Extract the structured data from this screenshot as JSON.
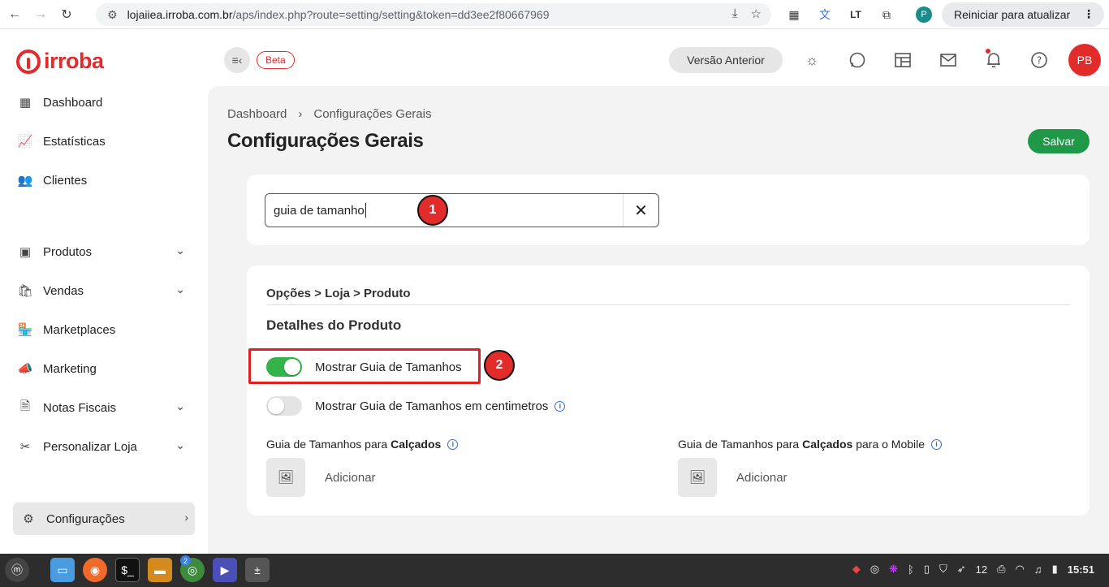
{
  "browser": {
    "url_host": "lojaiiea.irroba.com.br",
    "url_path": "/aps/index.php?route=setting/setting&token=dd3ee2f80667969",
    "profile_initial": "P",
    "restart_label": "Reiniciar para atualizar",
    "menu_glyph": "⋮"
  },
  "header": {
    "logo_text": "irroba",
    "beta_label": "Beta",
    "prev_version_label": "Versão Anterior",
    "avatar_initials": "PB",
    "icons": [
      "theme-icon",
      "whatsapp-icon",
      "layout-icon",
      "mail-icon",
      "bell-icon",
      "help-icon"
    ]
  },
  "sidebar": {
    "items": [
      {
        "label": "Dashboard",
        "icon": "dashboard-icon"
      },
      {
        "label": "Estatísticas",
        "icon": "stats-icon"
      },
      {
        "label": "Clientes",
        "icon": "clients-icon"
      },
      {
        "label": "Produtos",
        "icon": "products-icon"
      },
      {
        "label": "Vendas",
        "icon": "sales-icon"
      },
      {
        "label": "Marketplaces",
        "icon": "marketplaces-icon"
      },
      {
        "label": "Marketing",
        "icon": "marketing-icon"
      },
      {
        "label": "Notas Fiscais",
        "icon": "invoices-icon"
      },
      {
        "label": "Personalizar Loja",
        "icon": "customize-icon"
      },
      {
        "label": "Configurações",
        "icon": "settings-icon"
      }
    ]
  },
  "main": {
    "breadcrumb": [
      "Dashboard",
      "Configurações Gerais"
    ],
    "breadcrumb_sep": "›",
    "title": "Configurações Gerais",
    "save_label": "Salvar",
    "search_value": "guia de tamanho",
    "markers": [
      "1",
      "2"
    ],
    "section_path": "Opções > Loja > Produto",
    "section_title": "Detalhes do Produto",
    "toggles": [
      {
        "label": "Mostrar Guia de Tamanhos",
        "on": true
      },
      {
        "label": "Mostrar Guia de Tamanhos em centimetros",
        "on": false
      }
    ],
    "guide_desktop": {
      "prefix": "Guia de Tamanhos para ",
      "bold": "Calçados",
      "suffix": ""
    },
    "guide_mobile": {
      "prefix": "Guia de Tamanhos para ",
      "bold": "Calçados",
      "suffix": " para o Mobile"
    },
    "add_label": "Adicionar"
  },
  "taskbar": {
    "badge_count": "2",
    "tray_count": "12",
    "clock": "15:51"
  },
  "colors": {
    "brand": "#e22b2b",
    "save_green": "#1f9948",
    "toggle_on": "#34b34a"
  }
}
